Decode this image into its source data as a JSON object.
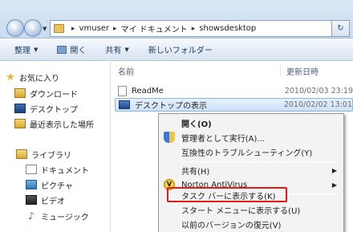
{
  "address": {
    "crumbs": [
      "vmuser",
      "マイ ドキュメント",
      "showsdesktop"
    ],
    "refresh_icon": "refresh-icon"
  },
  "toolbar": {
    "organize": "整理",
    "open": "開く",
    "share": "共有",
    "new_folder": "新しいフォルダー"
  },
  "nav": {
    "favorites": "お気に入り",
    "downloads": "ダウンロード",
    "desktop": "デスクトップ",
    "recent": "最近表示した場所",
    "libraries": "ライブラリ",
    "documents": "ドキュメント",
    "pictures": "ピクチャ",
    "videos": "ビデオ",
    "music": "ミュージック"
  },
  "columns": {
    "name": "名前",
    "date": "更新日時"
  },
  "files": [
    {
      "name": "ReadMe",
      "date": "2010/02/03 23:19",
      "icon": "text-file-icon"
    },
    {
      "name": "デスクトップの表示",
      "date": "2010/02/02 13:01",
      "icon": "shortcut-icon",
      "selected": true
    }
  ],
  "context_menu": {
    "open": "開く(O)",
    "run_as_admin": "管理者として実行(A)...",
    "troubleshoot": "互換性のトラブルシューティング(Y)",
    "share": "共有(H)",
    "norton": "Norton AntiVirus",
    "pin_taskbar": "タスク バーに表示する(K)",
    "pin_start": "スタート メニューに表示する(U)",
    "restore": "以前のバージョンの復元(V)"
  },
  "colors": {
    "highlight_box": "#e01b1b",
    "selection": "#cde1f7"
  }
}
